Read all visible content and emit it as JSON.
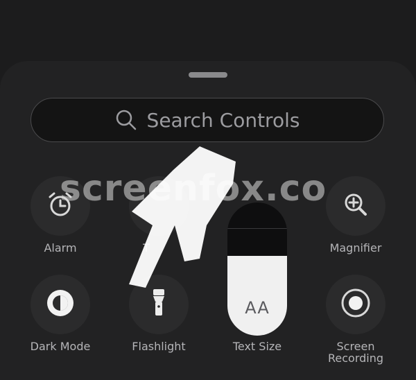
{
  "search": {
    "placeholder": "Search Controls"
  },
  "controls": [
    {
      "id": "alarm",
      "label": "Alarm",
      "icon": "alarm-clock-icon"
    },
    {
      "id": "timer",
      "label": "T",
      "icon": "timer-icon"
    },
    {
      "id": "magnifier",
      "label": "Magnifier",
      "icon": "magnifier-icon"
    },
    {
      "id": "dark-mode",
      "label": "Dark Mode",
      "icon": "dark-mode-icon"
    },
    {
      "id": "flashlight",
      "label": "Flashlight",
      "icon": "flashlight-icon"
    },
    {
      "id": "text-size",
      "label": "Text Size",
      "icon_text": "AA",
      "level": 0.6
    },
    {
      "id": "screen-recording",
      "label_line1": "Screen",
      "label_line2": "Recording",
      "icon": "record-icon"
    }
  ],
  "watermark": "screenfox.co",
  "colors": {
    "background": "#1c1c1d",
    "panel": "#222223",
    "button": "#2b2b2c"
  }
}
